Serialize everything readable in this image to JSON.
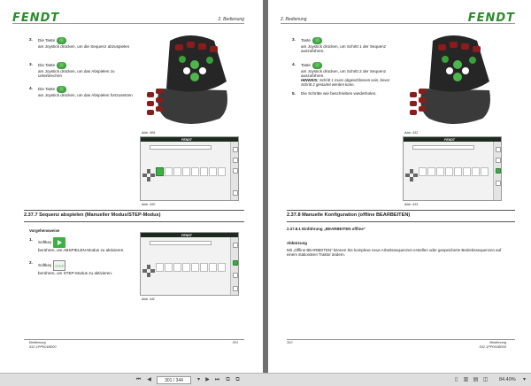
{
  "left_page": {
    "logo": "FENDT",
    "chapter": "2. Bedienung",
    "steps_top": [
      {
        "num": "2.",
        "pre": "Die Taste",
        "post": "am Joystick drücken, um die Sequenz abzuspielen"
      },
      {
        "num": "3.",
        "pre": "Die Taste",
        "post": "am Joystick drücken, um das Abspielen zu unterbrechen"
      },
      {
        "num": "4.",
        "pre": "Die Taste",
        "post": "am Joystick drücken, um das Abspielen fortzusetzen"
      }
    ],
    "fig1_caption": "Abb. 409",
    "fig2_caption": "Abb. 410",
    "section_title": "2.37.7  Sequenz abspielen (Manueller Modus/STEP-Modus)",
    "procedure_label": "Vorgehensweise",
    "steps_bottom": [
      {
        "num": "1.",
        "pre": "Softkey",
        "post": "berühren, um ABSPIELEN-Modus zu aktivieren."
      },
      {
        "num": "2.",
        "pre": "Softkey",
        "post": "berühren, um STEP-Modus zu aktivieren."
      }
    ],
    "fig3_caption": "Abb. 411",
    "footer_left": "Bedienung\n532.1PP001B000",
    "page_number": "301"
  },
  "right_page": {
    "logo": "FENDT",
    "chapter": "2. Bedienung",
    "steps_top": [
      {
        "num": "3.",
        "pre": "Taste",
        "post": "am Joystick drücken, um Schritt 1 der Sequenz auszuführen."
      },
      {
        "num": "4.",
        "pre": "Taste",
        "post": "am Joystick drücken, um Schritt 2 der Sequenz auszuführen."
      },
      {
        "num": "5.",
        "pre": "",
        "post": "Die Schritte wie beschrieben wiederholen."
      }
    ],
    "hint_label": "HINWEIS:",
    "hint_text": "Schritt 1 muss abgeschlossen sein, bevor Schritt 2 gestartet werden kann.",
    "fig1_caption": "Abb. 412",
    "fig2_caption": "Abb. 413",
    "section_title": "2.37.8  Manuelle Konfiguration (offline BEARBEITEN)",
    "subsection": "2.37.8.1  Einführung „BEARBEITEN offline“",
    "abbrev_label": "Abkürzung",
    "body": "Mit „Offline BEARBEITEN“ können Sie komplexe neue Arbeitssequenzen erstellen oder gespeicherte Betriebssequenzen auf einem stationären Traktor ändern.",
    "footer_right": "Bedienung\n532.1PP001B000",
    "page_number": "302"
  },
  "screen": {
    "brand": "FENDT",
    "step_label": "STEP"
  },
  "toolbar": {
    "page_value": "301 / 344",
    "zoom": "84.40%",
    "first_icon": "first-page-icon",
    "prev_icon": "previous-page-icon",
    "next_icon": "next-page-icon",
    "last_icon": "last-page-icon"
  },
  "colors": {
    "fendt_green": "#2e8b2e",
    "key_green": "#3cb043"
  }
}
